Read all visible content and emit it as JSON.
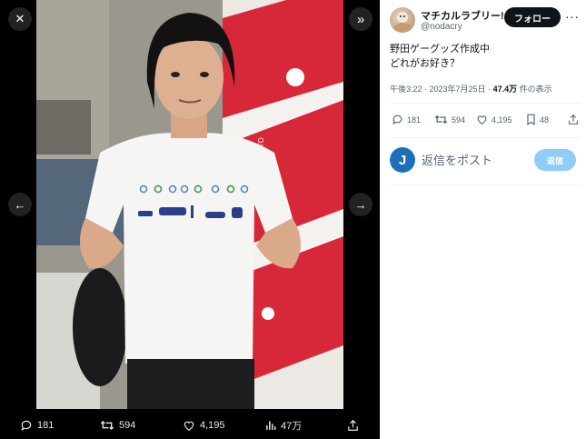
{
  "viewer": {
    "close_icon": "close-icon",
    "collapse_icon": "double-chevron-right-icon",
    "prev_icon": "arrow-left-icon",
    "next_icon": "arrow-right-icon",
    "actions": {
      "replies": "181",
      "reposts": "594",
      "likes": "4,195",
      "views": "47万"
    }
  },
  "tweet": {
    "display_name": "マチカルラブリー!",
    "handle": "@nodacry",
    "follow_label": "フォロー",
    "more_label": "···",
    "text_line1": "野田ゲーグッズ作成中",
    "text_line2": "どれがお好き？",
    "time": "午後3:22 · 2023年7月25日 · ",
    "views_count": "47.4万",
    "views_suffix": " 件の表示",
    "stats": {
      "replies": "181",
      "reposts": "594",
      "likes": "4,195",
      "bookmarks": "48"
    },
    "reply_avatar_letter": "J",
    "reply_placeholder": "返信をポスト",
    "reply_button": "返信"
  },
  "colors": {
    "accent": "#1d9bf0",
    "reply_button": "#8ecdf8",
    "red_backdrop": "#d7283a"
  }
}
